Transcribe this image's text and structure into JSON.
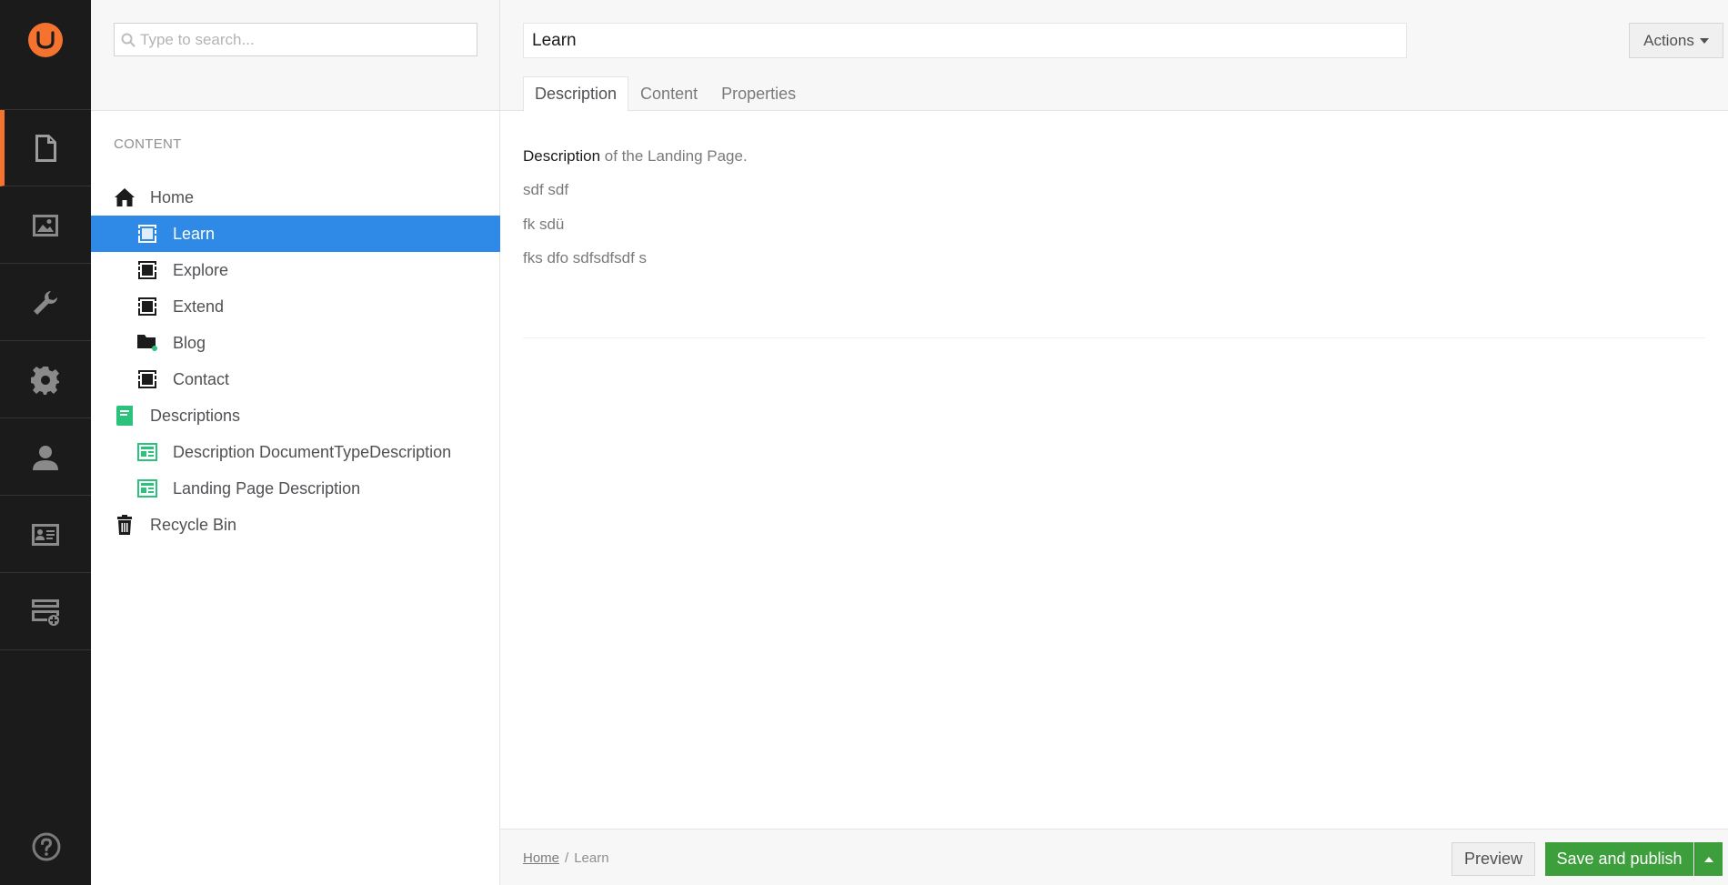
{
  "colors": {
    "accent": "#f5732e",
    "selected": "#2e8ae6",
    "publish": "#3c9f3c",
    "appbar": "#1b1b1b",
    "descriptions_green": "#2bc37c"
  },
  "appbar": {
    "logo_icon": "umbraco-logo-icon",
    "sections": [
      {
        "name": "content",
        "icon": "document-icon",
        "active": true
      },
      {
        "name": "media",
        "icon": "image-icon",
        "active": false
      },
      {
        "name": "settings",
        "icon": "wrench-icon",
        "active": false
      },
      {
        "name": "developer",
        "icon": "gear-icon",
        "active": false
      },
      {
        "name": "users",
        "icon": "user-icon",
        "active": false
      },
      {
        "name": "members",
        "icon": "id-card-icon",
        "active": false
      },
      {
        "name": "forms",
        "icon": "forms-icon",
        "active": false
      }
    ],
    "help_icon": "help-icon"
  },
  "tree": {
    "search_placeholder": "Type to search...",
    "section_label": "CONTENT",
    "nodes": [
      {
        "label": "Home",
        "level": 0,
        "icon": "home-icon",
        "selected": false
      },
      {
        "label": "Learn",
        "level": 1,
        "icon": "landing-page-icon",
        "selected": true
      },
      {
        "label": "Explore",
        "level": 1,
        "icon": "landing-page-icon",
        "selected": false
      },
      {
        "label": "Extend",
        "level": 1,
        "icon": "landing-page-icon",
        "selected": false
      },
      {
        "label": "Blog",
        "level": 1,
        "icon": "folder-icon",
        "selected": false
      },
      {
        "label": "Contact",
        "level": 1,
        "icon": "landing-page-icon",
        "selected": false
      },
      {
        "label": "Descriptions",
        "level": 0,
        "icon": "book-icon",
        "selected": false
      },
      {
        "label": "Description DocumentTypeDescription",
        "level": 1,
        "icon": "newspaper-icon",
        "selected": false
      },
      {
        "label": "Landing Page Description",
        "level": 1,
        "icon": "newspaper-icon",
        "selected": false
      },
      {
        "label": "Recycle Bin",
        "level": 0,
        "icon": "trash-icon",
        "selected": false
      }
    ]
  },
  "editor": {
    "name_value": "Learn",
    "actions_label": "Actions",
    "tabs": [
      {
        "label": "Description",
        "active": true
      },
      {
        "label": "Content",
        "active": false
      },
      {
        "label": "Properties",
        "active": false
      }
    ],
    "description": {
      "first_bold": "Description",
      "first_rest": " of the Landing Page.",
      "lines": [
        "sdf sdf",
        "fk sdü",
        "fks dfo sdfsdfsdf s"
      ]
    }
  },
  "footer": {
    "breadcrumb_home": "Home",
    "breadcrumb_sep": "/",
    "breadcrumb_current": "Learn",
    "preview_label": "Preview",
    "publish_label": "Save and publish"
  }
}
